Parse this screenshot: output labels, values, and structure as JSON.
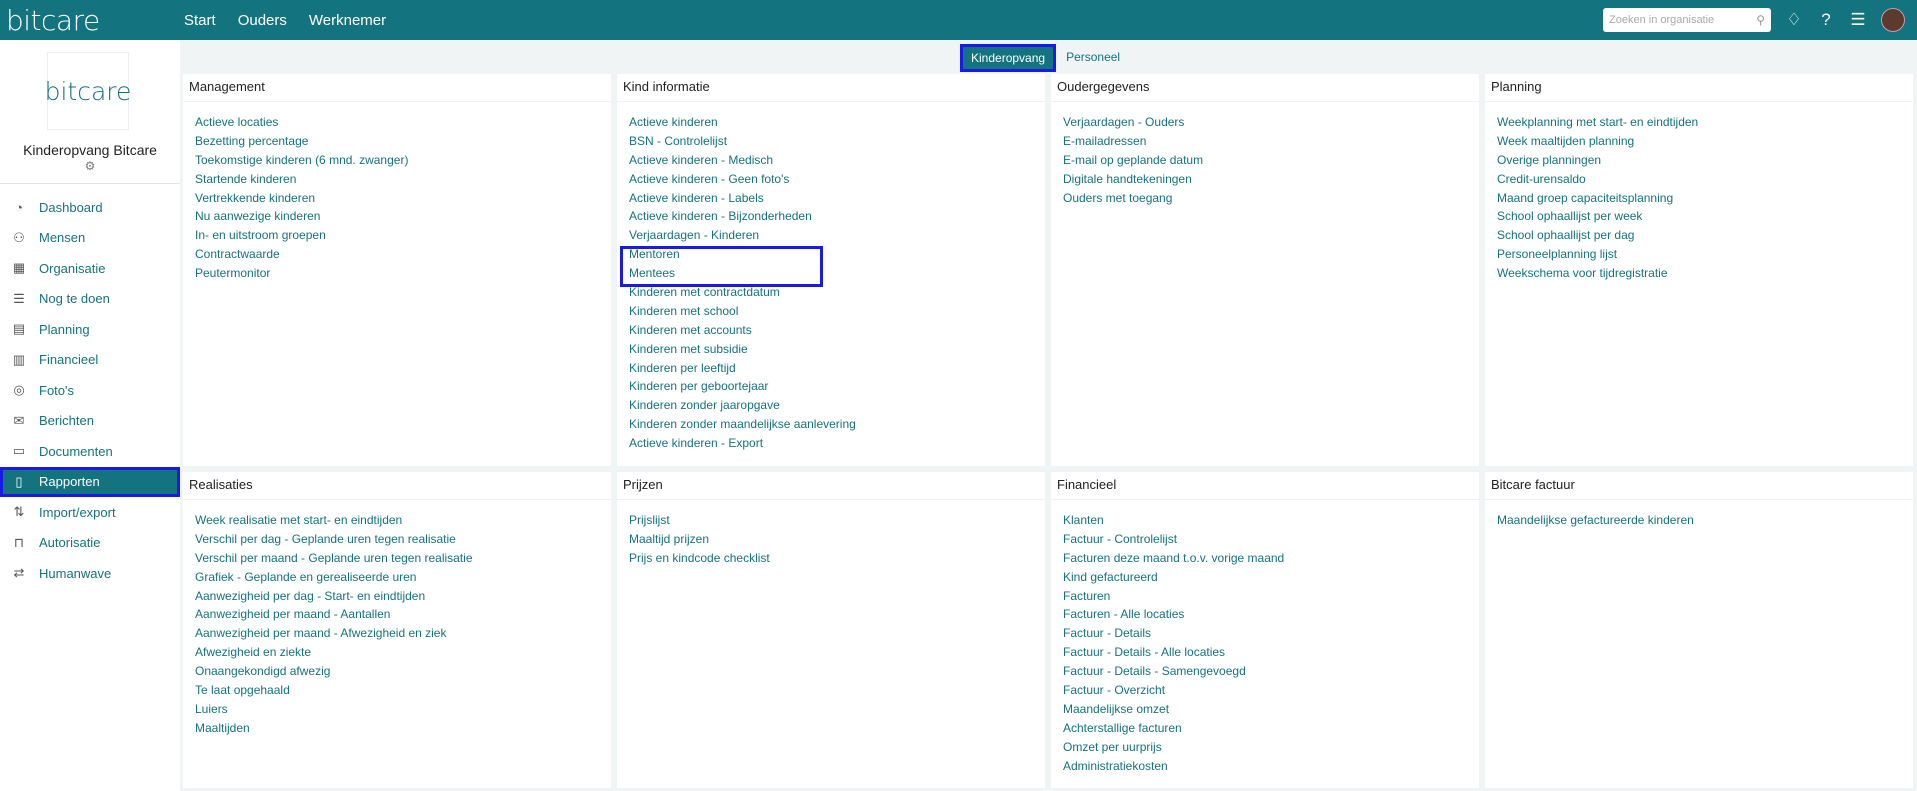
{
  "header": {
    "logo": "bitcare",
    "nav": [
      "Start",
      "Ouders",
      "Werknemer"
    ],
    "search_placeholder": "Zoeken in organisatie",
    "icons": [
      "search-icon",
      "bell-icon",
      "help-icon",
      "graduation-icon"
    ]
  },
  "sidebar": {
    "logo": "bitcare",
    "org_name": "Kinderopvang Bitcare",
    "items": [
      {
        "label": "Dashboard",
        "icon": "◔"
      },
      {
        "label": "Mensen",
        "icon": "⚇"
      },
      {
        "label": "Organisatie",
        "icon": "▦"
      },
      {
        "label": "Nog te doen",
        "icon": "☰"
      },
      {
        "label": "Planning",
        "icon": "▤"
      },
      {
        "label": "Financieel",
        "icon": "▥"
      },
      {
        "label": "Foto's",
        "icon": "◎"
      },
      {
        "label": "Berichten",
        "icon": "✉"
      },
      {
        "label": "Documenten",
        "icon": "▭"
      },
      {
        "label": "Rapporten",
        "icon": "▯"
      },
      {
        "label": "Import/export",
        "icon": "⇅"
      },
      {
        "label": "Autorisatie",
        "icon": "⊓"
      },
      {
        "label": "Humanwave",
        "icon": "⇄"
      }
    ]
  },
  "tabs": [
    "Kinderopvang",
    "Personeel"
  ],
  "panels": [
    {
      "title": "Management",
      "links": [
        "Actieve locaties",
        "Bezetting percentage",
        "Toekomstige kinderen (6 mnd. zwanger)",
        "Startende kinderen",
        "Vertrekkende kinderen",
        "Nu aanwezige kinderen",
        "In- en uitstroom groepen",
        "Contractwaarde",
        "Peutermonitor"
      ]
    },
    {
      "title": "Kind informatie",
      "links": [
        "Actieve kinderen",
        "BSN - Controlelijst",
        "Actieve kinderen - Medisch",
        "Actieve kinderen - Geen foto's",
        "Actieve kinderen - Labels",
        "Actieve kinderen - Bijzonderheden",
        "Verjaardagen - Kinderen",
        "Mentoren",
        "Mentees",
        "Kinderen met contractdatum",
        "Kinderen met school",
        "Kinderen met accounts",
        "Kinderen met subsidie",
        "Kinderen per leeftijd",
        "Kinderen per geboortejaar",
        "Kinderen zonder jaaropgave",
        "Kinderen zonder maandelijkse aanlevering",
        "Actieve kinderen - Export"
      ]
    },
    {
      "title": "Oudergegevens",
      "links": [
        "Verjaardagen - Ouders",
        "E-mailadressen",
        "E-mail op geplande datum",
        "Digitale handtekeningen",
        "Ouders met toegang"
      ]
    },
    {
      "title": "Planning",
      "links": [
        "Weekplanning met start- en eindtijden",
        "Week maaltijden planning",
        "Overige planningen",
        "Credit-urensaldo",
        "Maand groep capaciteitsplanning",
        "School ophaallijst per week",
        "School ophaallijst per dag",
        "Personeelplanning lijst",
        "Weekschema voor tijdregistratie"
      ]
    },
    {
      "title": "Realisaties",
      "links": [
        "Week realisatie met start- en eindtijden",
        "Verschil per dag - Geplande uren tegen realisatie",
        "Verschil per maand - Geplande uren tegen realisatie",
        "Grafiek - Geplande en gerealiseerde uren",
        "Aanwezigheid per dag - Start- en eindtijden",
        "Aanwezigheid per maand - Aantallen",
        "Aanwezigheid per maand - Afwezigheid en ziek",
        "Afwezigheid en ziekte",
        "Onaangekondigd afwezig",
        "Te laat opgehaald",
        "Luiers",
        "Maaltijden"
      ]
    },
    {
      "title": "Prijzen",
      "links": [
        "Prijslijst",
        "Maaltijd prijzen",
        "Prijs en kindcode checklist"
      ]
    },
    {
      "title": "Financieel",
      "links": [
        "Klanten",
        "Factuur - Controlelijst",
        "Facturen deze maand t.o.v. vorige maand",
        "Kind gefactureerd",
        "Facturen",
        "Facturen - Alle locaties",
        "Factuur - Details",
        "Factuur - Details - Alle locaties",
        "Factuur - Details - Samengevoegd",
        "Factuur - Overzicht",
        "Maandelijkse omzet",
        "Achterstallige facturen",
        "Omzet per uurprijs",
        "Administratiekosten"
      ]
    },
    {
      "title": "Bitcare factuur",
      "links": [
        "Maandelijkse gefactureerde kinderen"
      ]
    }
  ]
}
